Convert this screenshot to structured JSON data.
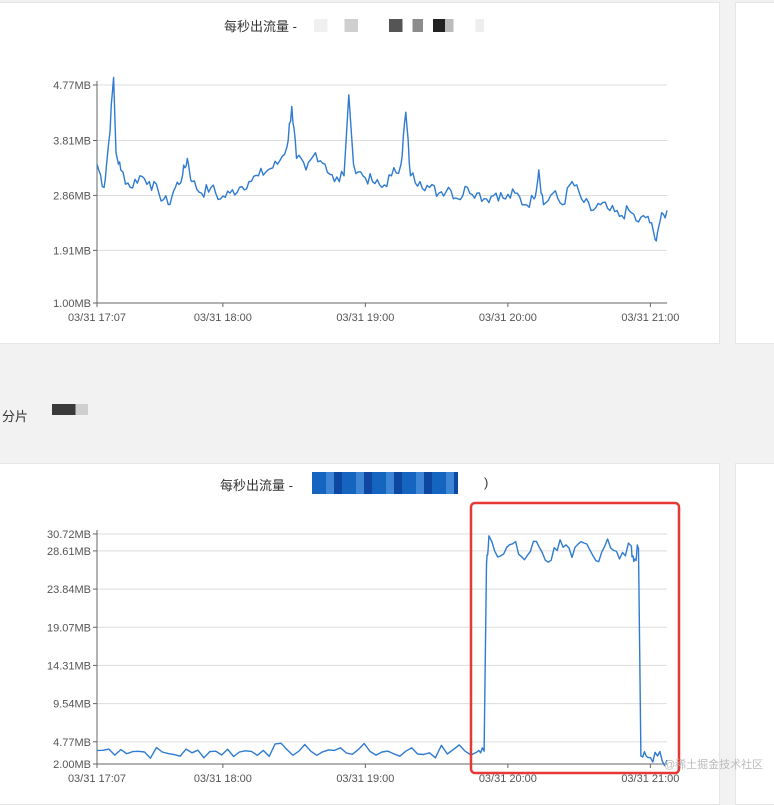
{
  "section": {
    "label": "分片"
  },
  "watermark": "@稀土掘金技术社区",
  "charts": {
    "top": {
      "title": "每秒出流量 -",
      "title_suffix": ""
    },
    "bottom": {
      "title": "每秒出流量 -",
      "title_suffix": ")"
    }
  },
  "colors": {
    "line": "#2e7bd1",
    "grid": "#dddddd",
    "highlight": "#e53935",
    "mask_top": "#8a8a8a",
    "mask_bottom": "#1565c0"
  },
  "chart_data": [
    {
      "type": "line",
      "title": "每秒出流量 -",
      "x_ticks": [
        "03/31 17:07",
        "03/31 18:00",
        "03/31 19:00",
        "03/31 20:00",
        "03/31 21:00"
      ],
      "y_ticks": [
        "1.00MB",
        "1.91MB",
        "2.86MB",
        "3.81MB",
        "4.77MB"
      ],
      "ylim": [
        1.0,
        4.77
      ],
      "x_range_minutes": [
        0,
        240
      ],
      "series": [
        {
          "values": [
            [
              0,
              3.4
            ],
            [
              3,
              3.0
            ],
            [
              5,
              3.8
            ],
            [
              7,
              4.9
            ],
            [
              8,
              3.6
            ],
            [
              10,
              3.3
            ],
            [
              14,
              3.0
            ],
            [
              18,
              3.2
            ],
            [
              22,
              3.1
            ],
            [
              26,
              2.9
            ],
            [
              30,
              2.7
            ],
            [
              33,
              3.0
            ],
            [
              36,
              3.2
            ],
            [
              38,
              3.5
            ],
            [
              40,
              3.1
            ],
            [
              44,
              2.9
            ],
            [
              48,
              3.0
            ],
            [
              52,
              2.8
            ],
            [
              56,
              2.9
            ],
            [
              60,
              3.0
            ],
            [
              64,
              3.1
            ],
            [
              68,
              3.2
            ],
            [
              72,
              3.3
            ],
            [
              76,
              3.4
            ],
            [
              80,
              3.7
            ],
            [
              82,
              4.4
            ],
            [
              84,
              3.5
            ],
            [
              88,
              3.3
            ],
            [
              92,
              3.6
            ],
            [
              96,
              3.4
            ],
            [
              100,
              3.1
            ],
            [
              104,
              3.2
            ],
            [
              106,
              4.6
            ],
            [
              108,
              3.4
            ],
            [
              112,
              3.2
            ],
            [
              116,
              3.1
            ],
            [
              120,
              3.0
            ],
            [
              124,
              3.2
            ],
            [
              128,
              3.4
            ],
            [
              130,
              4.3
            ],
            [
              132,
              3.2
            ],
            [
              136,
              3.1
            ],
            [
              140,
              3.0
            ],
            [
              144,
              2.9
            ],
            [
              148,
              3.0
            ],
            [
              152,
              2.8
            ],
            [
              156,
              3.0
            ],
            [
              160,
              2.9
            ],
            [
              164,
              2.8
            ],
            [
              168,
              2.9
            ],
            [
              172,
              2.8
            ],
            [
              176,
              2.9
            ],
            [
              180,
              2.7
            ],
            [
              184,
              2.8
            ],
            [
              186,
              3.3
            ],
            [
              188,
              2.7
            ],
            [
              192,
              2.9
            ],
            [
              196,
              2.7
            ],
            [
              200,
              3.1
            ],
            [
              204,
              2.8
            ],
            [
              208,
              2.6
            ],
            [
              212,
              2.7
            ],
            [
              216,
              2.6
            ],
            [
              220,
              2.5
            ],
            [
              224,
              2.6
            ],
            [
              228,
              2.4
            ],
            [
              232,
              2.5
            ],
            [
              235,
              2.1
            ],
            [
              237,
              2.4
            ],
            [
              240,
              2.6
            ]
          ]
        }
      ]
    },
    {
      "type": "line",
      "title": "每秒出流量 -",
      "x_ticks": [
        "03/31 17:07",
        "03/31 18:00",
        "03/31 19:00",
        "03/31 20:00",
        "03/31 21:00"
      ],
      "y_ticks": [
        "2.00MB",
        "4.77MB",
        "9.54MB",
        "14.31MB",
        "19.07MB",
        "23.84MB",
        "28.61MB",
        "30.72MB"
      ],
      "ylim": [
        2.0,
        30.72
      ],
      "x_range_minutes": [
        0,
        240
      ],
      "series": [
        {
          "values": [
            [
              0,
              3.7
            ],
            [
              10,
              3.8
            ],
            [
              20,
              3.5
            ],
            [
              30,
              3.3
            ],
            [
              40,
              3.4
            ],
            [
              50,
              3.6
            ],
            [
              60,
              3.5
            ],
            [
              70,
              3.7
            ],
            [
              80,
              3.8
            ],
            [
              90,
              3.6
            ],
            [
              100,
              3.7
            ],
            [
              110,
              3.8
            ],
            [
              120,
              3.5
            ],
            [
              130,
              3.6
            ],
            [
              140,
              3.4
            ],
            [
              150,
              3.8
            ],
            [
              160,
              3.5
            ],
            [
              163,
              3.6
            ],
            [
              164,
              27.0
            ],
            [
              165,
              30.5
            ],
            [
              170,
              28.0
            ],
            [
              175,
              29.5
            ],
            [
              180,
              27.5
            ],
            [
              185,
              29.8
            ],
            [
              190,
              27.2
            ],
            [
              195,
              30.0
            ],
            [
              200,
              27.8
            ],
            [
              205,
              29.6
            ],
            [
              210,
              27.4
            ],
            [
              215,
              30.1
            ],
            [
              220,
              27.6
            ],
            [
              225,
              29.2
            ],
            [
              226,
              27.3
            ],
            [
              228,
              28.9
            ],
            [
              229,
              3.0
            ],
            [
              232,
              2.8
            ],
            [
              236,
              3.0
            ],
            [
              240,
              2.5
            ]
          ]
        }
      ]
    }
  ]
}
